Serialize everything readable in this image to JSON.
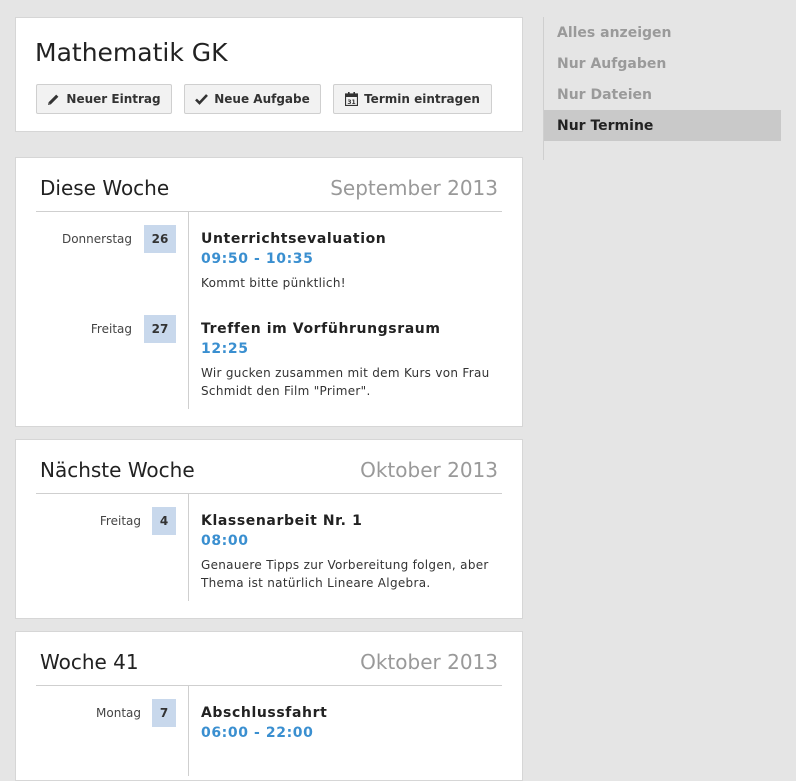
{
  "course": {
    "title": "Mathematik GK",
    "buttons": {
      "new_entry": "Neuer Eintrag",
      "new_task": "Neue Aufgabe",
      "add_date": "Termin eintragen"
    }
  },
  "sidebar": {
    "items": [
      {
        "label": "Alles anzeigen",
        "active": false
      },
      {
        "label": "Nur Aufgaben",
        "active": false
      },
      {
        "label": "Nur Dateien",
        "active": false
      },
      {
        "label": "Nur Termine",
        "active": true
      }
    ]
  },
  "weeks": [
    {
      "title": "Diese Woche",
      "month": "September 2013",
      "events": [
        {
          "day": "Donnerstag",
          "date": "26",
          "title": "Unterrichtsevaluation",
          "time": "09:50 - 10:35",
          "desc": "Kommt bitte pünktlich!"
        },
        {
          "day": "Freitag",
          "date": "27",
          "title": "Treffen im Vorführungsraum",
          "time": "12:25",
          "desc": "Wir gucken zusammen mit dem Kurs von Frau Schmidt den Film \"Primer\"."
        }
      ]
    },
    {
      "title": "Nächste Woche",
      "month": "Oktober 2013",
      "events": [
        {
          "day": "Freitag",
          "date": "4",
          "title": "Klassenarbeit Nr. 1",
          "time": "08:00",
          "desc": "Genauere Tipps zur Vorbereitung folgen, aber Thema ist natürlich Lineare Algebra."
        }
      ]
    },
    {
      "title": "Woche 41",
      "month": "Oktober 2013",
      "events": [
        {
          "day": "Montag",
          "date": "7",
          "title": "Abschlussfahrt",
          "time": "06:00 - 22:00",
          "desc": ""
        }
      ]
    }
  ],
  "colors": {
    "accent_time": "#3a8fd0",
    "date_badge": "#c8d8ec",
    "sidebar_active": "#c9c9c9",
    "background": "#e5e5e5"
  }
}
